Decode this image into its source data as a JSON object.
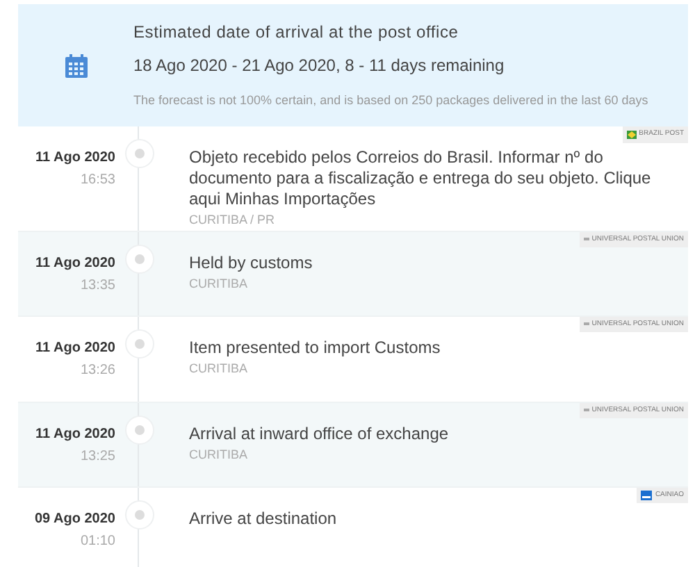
{
  "estimate": {
    "title": "Estimated date of arrival at the post office",
    "range": "18 Ago 2020 - 21 Ago 2020, 8 - 11 days remaining",
    "note": "The forecast is not 100% certain, and is based on 250 packages delivered in the last 60 days"
  },
  "events": [
    {
      "date": "11 Ago 2020",
      "time": "16:53",
      "text": "Objeto recebido pelos Correios do Brasil. Informar nº do documento para a fiscalização e entrega do seu objeto. Clique aqui Minhas Importações",
      "location": "CURITIBA / PR",
      "carrier": {
        "name": "BRAZIL POST",
        "kind": "flag"
      }
    },
    {
      "date": "11 Ago 2020",
      "time": "13:35",
      "text": "Held by customs",
      "location": "CURITIBA",
      "carrier": {
        "name": "UNIVERSAL POSTAL UNION",
        "kind": "dash"
      }
    },
    {
      "date": "11 Ago 2020",
      "time": "13:26",
      "text": "Item presented to import Customs",
      "location": "CURITIBA",
      "carrier": {
        "name": "UNIVERSAL POSTAL UNION",
        "kind": "dash"
      }
    },
    {
      "date": "11 Ago 2020",
      "time": "13:25",
      "text": "Arrival at inward office of exchange",
      "location": "CURITIBA",
      "carrier": {
        "name": "UNIVERSAL POSTAL UNION",
        "kind": "dash"
      }
    },
    {
      "date": "09 Ago 2020",
      "time": "01:10",
      "text": "Arrive at destination",
      "carrier": {
        "name": "CAINIAO",
        "kind": "box"
      }
    }
  ]
}
